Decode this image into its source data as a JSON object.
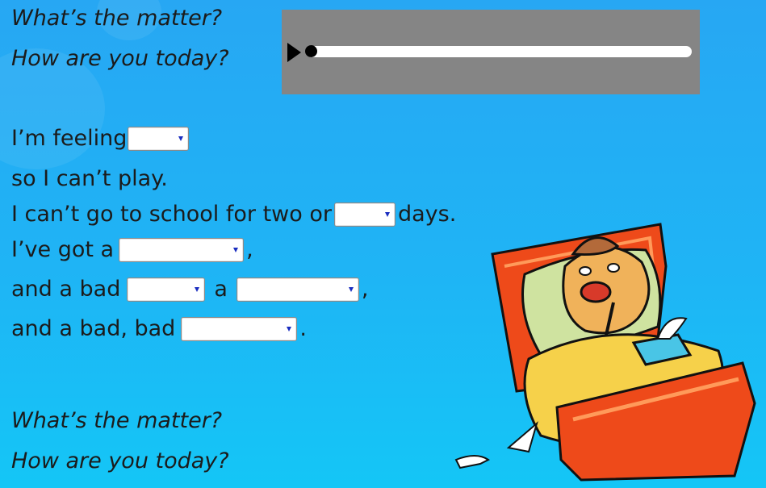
{
  "chorus_top": {
    "line1": "What’s the matter?",
    "line2": "How are you today?"
  },
  "chorus_bottom": {
    "line1": "What’s the matter?",
    "line2": "How are you today?"
  },
  "audio": {
    "progress": 0.0,
    "playing": false
  },
  "verse": {
    "line1_text": "I’m feeling",
    "line2_text": "so I can’t play.",
    "line3_before": "I can’t go to school for two or",
    "line3_after": "days.",
    "line4_before": "I’ve got a",
    "line4_after": ",",
    "line5_before": "and a bad",
    "line5_mid": "a",
    "line5_after": ",",
    "line6_before": "and a bad, bad",
    "line6_after": "."
  },
  "dropdowns": {
    "feeling": "",
    "days": "",
    "got_a": "",
    "bad1": "",
    "a2": "",
    "bad2": ""
  },
  "colors": {
    "background": "#1fb4f5",
    "player_bg": "#858585",
    "dropdown_arrow": "#1a2dbf"
  },
  "illustration": {
    "icon": "sick-dog-in-bed-illustration"
  }
}
